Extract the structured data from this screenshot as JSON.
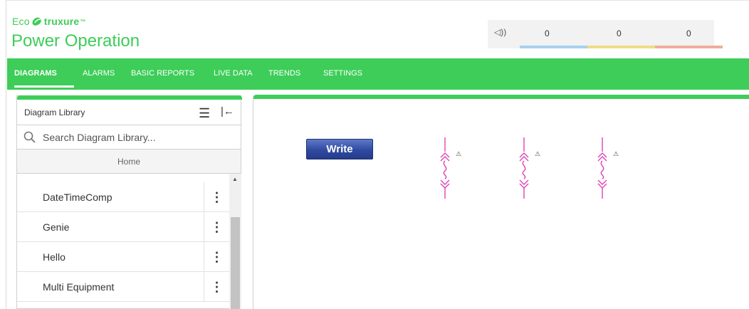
{
  "brand": {
    "logo_prefix": "Eco",
    "logo_suffix": "truxure",
    "logo_tm": "™",
    "app_title": "Power Operation",
    "accent_color": "#3dcd58"
  },
  "alarm_summary": {
    "icon": "speaker-icon",
    "counts": [
      {
        "value": "0",
        "color": "#a9d0ef"
      },
      {
        "value": "0",
        "color": "#f1dc84"
      },
      {
        "value": "0",
        "color": "#efae9b"
      }
    ]
  },
  "nav": {
    "items": [
      {
        "label": "DIAGRAMS",
        "active": true
      },
      {
        "label": "ALARMS",
        "active": false
      },
      {
        "label": "BASIC REPORTS",
        "active": false
      },
      {
        "label": "LIVE DATA",
        "active": false
      },
      {
        "label": "TRENDS",
        "active": false
      },
      {
        "label": "SETTINGS",
        "active": false
      }
    ]
  },
  "sidebar": {
    "title": "Diagram Library",
    "search_placeholder": "Search Diagram Library...",
    "home_label": "Home",
    "items": [
      {
        "label": "DateTimeComp"
      },
      {
        "label": "Genie"
      },
      {
        "label": "Hello"
      },
      {
        "label": "Multi Equipment"
      }
    ]
  },
  "canvas": {
    "write_button_label": "Write",
    "device_color": "#e040b8",
    "devices": [
      "breaker-1",
      "breaker-2",
      "breaker-3"
    ]
  }
}
